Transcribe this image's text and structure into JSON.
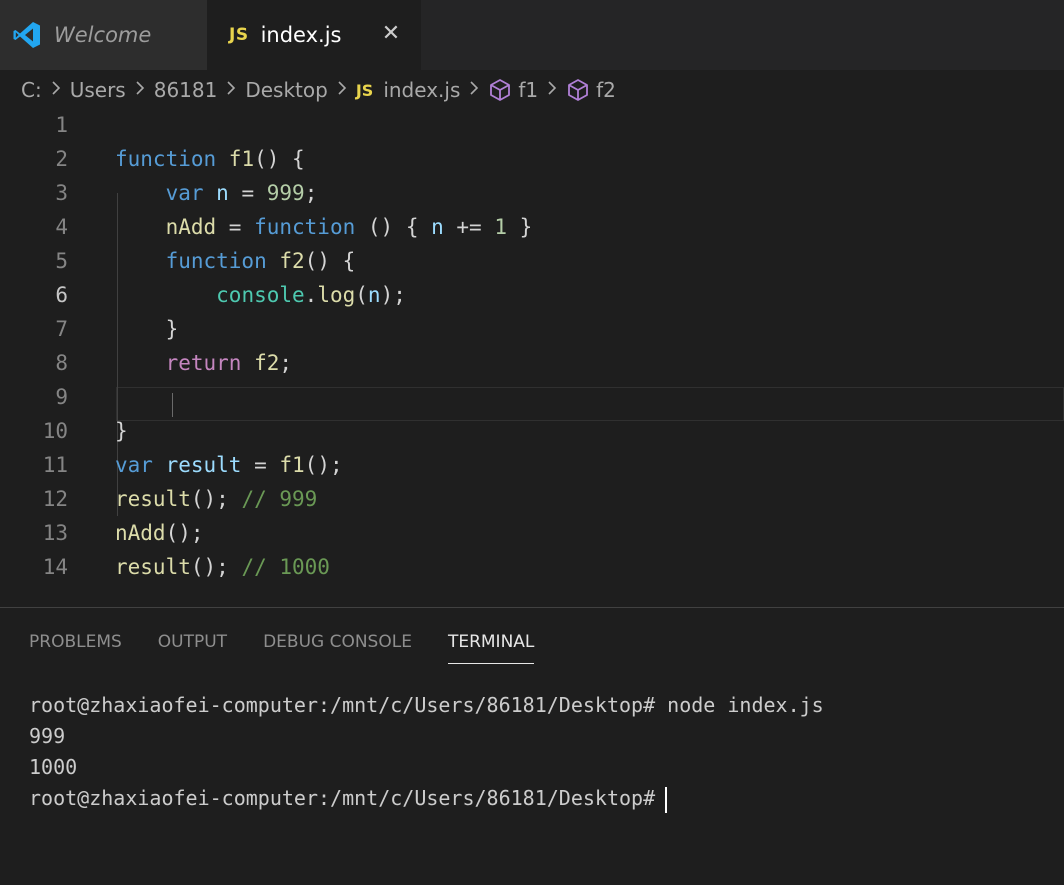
{
  "tabs": [
    {
      "label": "Welcome",
      "icon": "vscode-icon",
      "active": false
    },
    {
      "label": "index.js",
      "icon_text": "JS",
      "close_symbol": "✕",
      "active": true
    }
  ],
  "breadcrumb": {
    "items": [
      "C:",
      "Users",
      "86181",
      "Desktop",
      "index.js",
      "f1",
      "f2"
    ],
    "file_icon_text": "JS"
  },
  "editor": {
    "active_line": 6,
    "lines": [
      {
        "n": "1",
        "tokens": []
      },
      {
        "n": "2",
        "tokens": [
          [
            "k-blue",
            "function "
          ],
          [
            "fn",
            "f1"
          ],
          [
            "pl",
            "() {"
          ]
        ]
      },
      {
        "n": "3",
        "tokens": [
          [
            "pl",
            "    "
          ],
          [
            "k-blue",
            "var "
          ],
          [
            "var",
            "n"
          ],
          [
            "pl",
            " = "
          ],
          [
            "num",
            "999"
          ],
          [
            "pl",
            ";"
          ]
        ]
      },
      {
        "n": "4",
        "tokens": [
          [
            "pl",
            "    "
          ],
          [
            "fn",
            "nAdd"
          ],
          [
            "pl",
            " = "
          ],
          [
            "k-blue",
            "function"
          ],
          [
            "pl",
            " () { "
          ],
          [
            "var",
            "n"
          ],
          [
            "pl",
            " += "
          ],
          [
            "num",
            "1"
          ],
          [
            "pl",
            " }"
          ]
        ]
      },
      {
        "n": "5",
        "tokens": [
          [
            "pl",
            "    "
          ],
          [
            "k-blue",
            "function "
          ],
          [
            "fn",
            "f2"
          ],
          [
            "pl",
            "() {"
          ]
        ]
      },
      {
        "n": "6",
        "tokens": [
          [
            "pl",
            "        "
          ],
          [
            "cls",
            "console"
          ],
          [
            "pl",
            "."
          ],
          [
            "fn",
            "log"
          ],
          [
            "pl",
            "("
          ],
          [
            "var",
            "n"
          ],
          [
            "pl",
            ");"
          ]
        ]
      },
      {
        "n": "7",
        "tokens": [
          [
            "pl",
            "    }"
          ]
        ]
      },
      {
        "n": "8",
        "tokens": [
          [
            "pl",
            "    "
          ],
          [
            "k-purple",
            "return "
          ],
          [
            "fn",
            "f2"
          ],
          [
            "pl",
            ";"
          ]
        ]
      },
      {
        "n": "9",
        "tokens": []
      },
      {
        "n": "10",
        "tokens": [
          [
            "pl",
            "}"
          ]
        ]
      },
      {
        "n": "11",
        "tokens": [
          [
            "k-blue",
            "var "
          ],
          [
            "var",
            "result"
          ],
          [
            "pl",
            " = "
          ],
          [
            "fn",
            "f1"
          ],
          [
            "pl",
            "();"
          ]
        ]
      },
      {
        "n": "12",
        "tokens": [
          [
            "fn",
            "result"
          ],
          [
            "pl",
            "(); "
          ],
          [
            "cmt",
            "// 999"
          ]
        ]
      },
      {
        "n": "13",
        "tokens": [
          [
            "fn",
            "nAdd"
          ],
          [
            "pl",
            "();"
          ]
        ]
      },
      {
        "n": "14",
        "tokens": [
          [
            "fn",
            "result"
          ],
          [
            "pl",
            "(); "
          ],
          [
            "cmt",
            "// 1000"
          ]
        ]
      }
    ]
  },
  "panel": {
    "tabs": [
      "PROBLEMS",
      "OUTPUT",
      "DEBUG CONSOLE",
      "TERMINAL"
    ],
    "active_tab": "TERMINAL",
    "terminal_lines": [
      "root@zhaxiaofei-computer:/mnt/c/Users/86181/Desktop# node index.js",
      "999",
      "1000",
      "root@zhaxiaofei-computer:/mnt/c/Users/86181/Desktop#"
    ]
  },
  "colors": {
    "editor_bg": "#1e1e1e",
    "tab_bar_bg": "#252526",
    "keyword": "#569cd6",
    "control_keyword": "#c586c0",
    "function": "#dcdcaa",
    "variable": "#9cdcfe",
    "number": "#b5cea8",
    "class": "#4ec9b0",
    "comment": "#6a9955",
    "js_icon": "#e8d44d",
    "vscode_blue": "#22a6f0",
    "cube_purple": "#b180d7"
  }
}
